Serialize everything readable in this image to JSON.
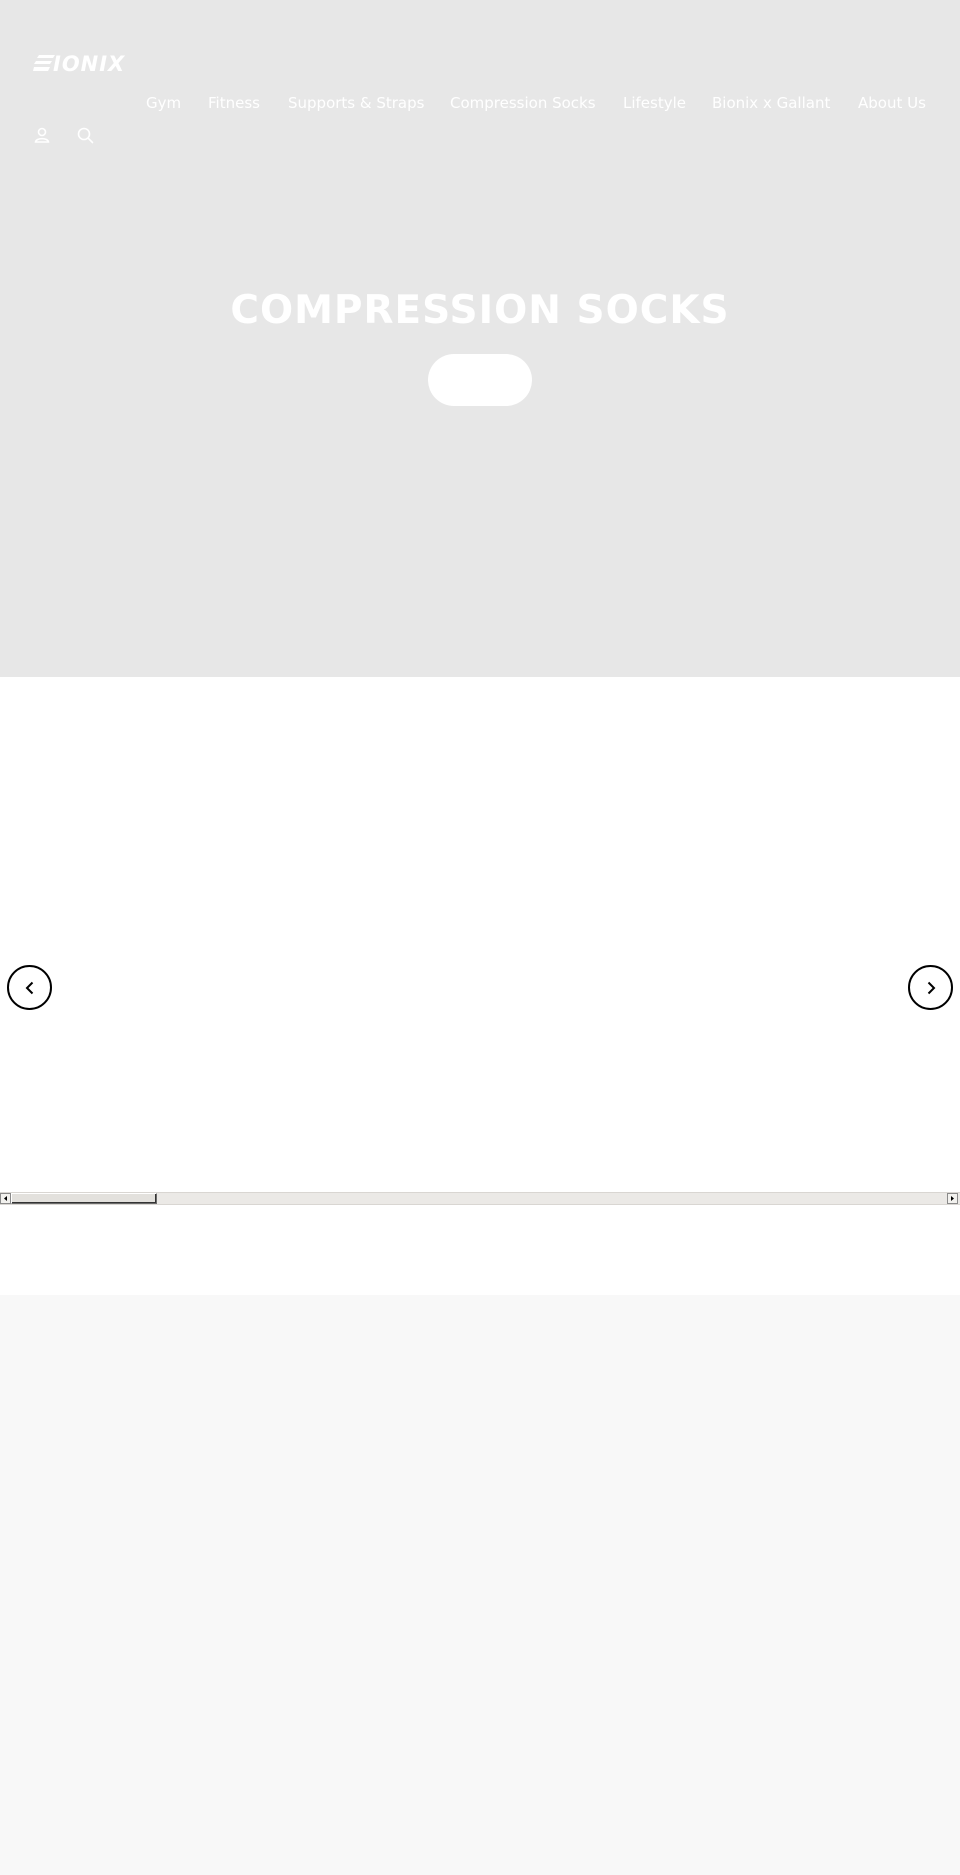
{
  "brand": {
    "logo_text": "BIONIX"
  },
  "nav": {
    "items": [
      {
        "label": "Gym"
      },
      {
        "label": "Fitness"
      },
      {
        "label": "Supports & Straps"
      },
      {
        "label": "Compression Socks"
      },
      {
        "label": "Lifestyle"
      },
      {
        "label": "Bionix x Gallant"
      },
      {
        "label": "About Us"
      }
    ]
  },
  "header_icons": [
    "account-icon",
    "search-icon"
  ],
  "hero": {
    "title": "COMPRESSION SOCKS",
    "button_label": ""
  },
  "carousel": {
    "prev_icon": "chevron-left-icon",
    "next_icon": "chevron-right-icon"
  },
  "colors": {
    "hero_bg": "#e7e7e7",
    "text_on_hero": "#ffffff",
    "lower_bg": "#f8f8f8"
  }
}
